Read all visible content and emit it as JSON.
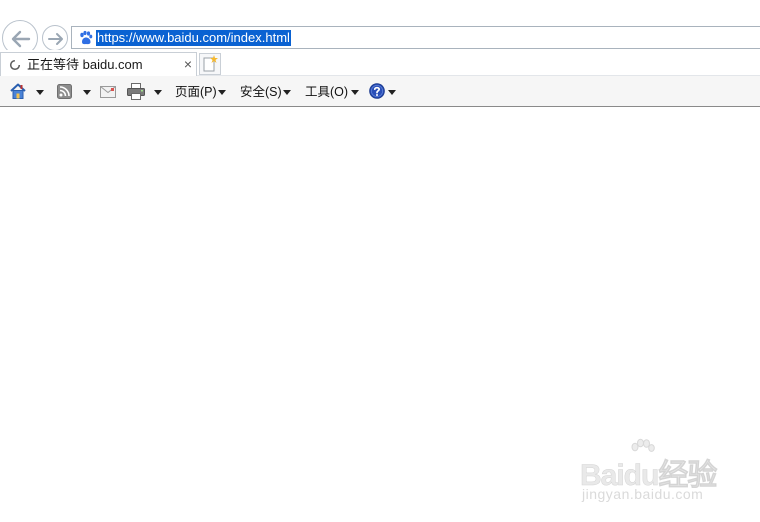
{
  "address_bar": {
    "url": "https://www.baidu.com/index.html",
    "site_icon": "baidu-paw-icon"
  },
  "nav": {
    "back_icon": "back-arrow-icon",
    "forward_icon": "forward-arrow-icon"
  },
  "tab": {
    "title": "正在等待 baidu.com",
    "close_glyph": "×",
    "loading_icon": "spinner-icon"
  },
  "command_bar": {
    "home_icon": "home-icon",
    "feeds_icon": "rss-icon",
    "mail_icon": "mail-icon",
    "print_icon": "print-icon",
    "page_menu": "页面(P)",
    "safety_menu": "安全(S)",
    "tools_menu": "工具(O)",
    "help_icon": "help-icon"
  },
  "watermark": {
    "brand": "Baidu经验",
    "sub": "jingyan.baidu.com"
  },
  "colors": {
    "url_highlight": "#0a62d2",
    "help_blue": "#2a4fb8",
    "baidu_blue": "#2f6fe4"
  }
}
